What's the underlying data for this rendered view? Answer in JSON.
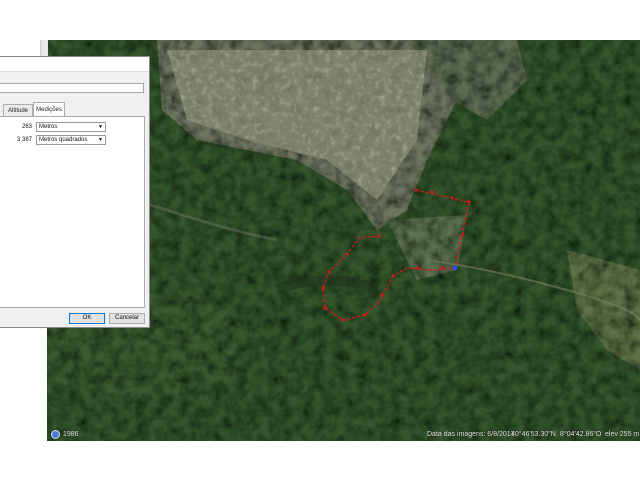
{
  "dialog": {
    "tabs": [
      {
        "label": "Altitude"
      },
      {
        "label": "Medições"
      }
    ],
    "measurements": {
      "length_value": "263",
      "length_unit": "Metros",
      "area_value": "3 387",
      "area_unit": "Metros quadrados"
    },
    "ok_label": "OK",
    "cancel_label": "Cancelar"
  },
  "map": {
    "imagery_date": "Data das imagens: 6/8/2017",
    "latitude": "40°46'53.30\"N",
    "longitude": "8°04'42.86\"O",
    "elevation": "elev   255 m",
    "year_label": "1986",
    "path_color": "#d11a1a",
    "node_color": "#2b4cff"
  }
}
